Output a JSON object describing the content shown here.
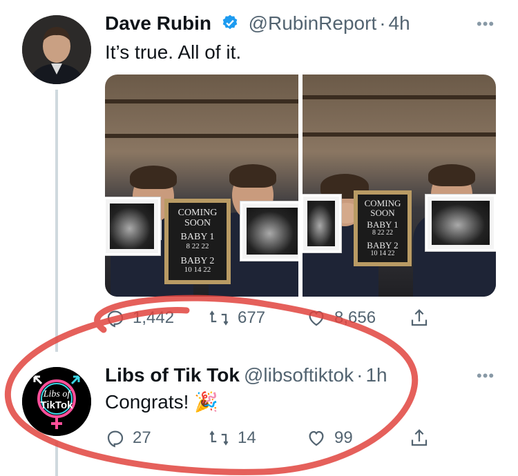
{
  "tweet1": {
    "name": "Dave Rubin",
    "handle": "@RubinReport",
    "time": "4h",
    "text": "It’s true. All of it.",
    "media": {
      "sign1": {
        "line1": "COMING",
        "line2": "SOON",
        "line3": "BABY 1",
        "line4": "8 22 22",
        "line5": "BABY 2",
        "line6": "10 14 22"
      },
      "sign2": {
        "line1": "COMING",
        "line2": "SOON",
        "line3": "BABY 1",
        "line4": "8 22 22",
        "line5": "BABY 2",
        "line6": "10 14 22"
      }
    },
    "replies": "1,442",
    "retweets": "677",
    "likes": "8,656"
  },
  "tweet2": {
    "name": "Libs of Tik Tok",
    "handle": "@libsoftiktok",
    "time": "1h",
    "text": "Congrats! 🎉",
    "avatar_text1": "Libs of",
    "avatar_text2": "TikTok",
    "replies": "27",
    "retweets": "14",
    "likes": "99"
  },
  "colors": {
    "accent": "#1d9bf0",
    "muted": "#536471",
    "annotation": "#e0443e"
  }
}
